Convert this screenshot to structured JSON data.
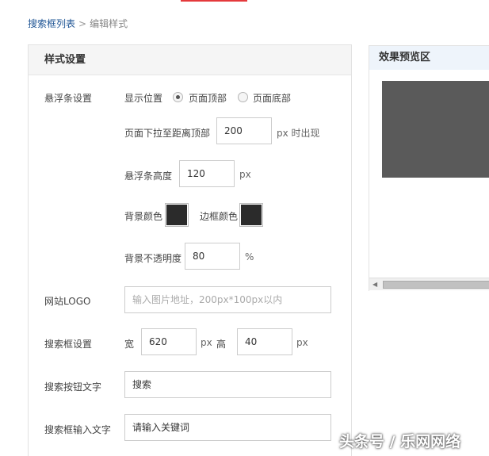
{
  "breadcrumb": {
    "parent": "搜索框列表",
    "separator": ">",
    "current": "编辑样式"
  },
  "settings": {
    "title": "样式设置",
    "float_bar": {
      "label": "悬浮条设置",
      "position_label": "显示位置",
      "options": [
        "页面顶部",
        "页面底部"
      ],
      "selected_option": "页面顶部",
      "scroll_prefix": "页面下拉至距离顶部",
      "scroll_value": "200",
      "scroll_suffix": "px 时出现",
      "height_label": "悬浮条高度",
      "height_value": "120",
      "height_unit": "px",
      "bg_color_label": "背景颜色",
      "border_color_label": "边框颜色",
      "opacity_label": "背景不透明度",
      "opacity_value": "80",
      "opacity_unit": "%"
    },
    "logo": {
      "label": "网站LOGO",
      "placeholder": "输入图片地址，200px*100px以内"
    },
    "search_box": {
      "label": "搜索框设置",
      "width_label": "宽",
      "width_value": "620",
      "width_unit": "px",
      "height_label": "高",
      "height_value": "40",
      "height_unit": "px"
    },
    "button_text": {
      "label": "搜索按钮文字",
      "value": "搜索"
    },
    "input_text": {
      "label": "搜索框输入文字",
      "value": "请输入关键词"
    }
  },
  "preview": {
    "title": "效果预览区"
  },
  "watermark": "头条号 / 乐网网络",
  "colors": {
    "accent_red": "#e4393c",
    "link_blue": "#1e5494",
    "bg_color_swatch": "#2b2b2b",
    "border_color_swatch": "#2b2b2b",
    "preview_box": "#5a5a5a"
  }
}
